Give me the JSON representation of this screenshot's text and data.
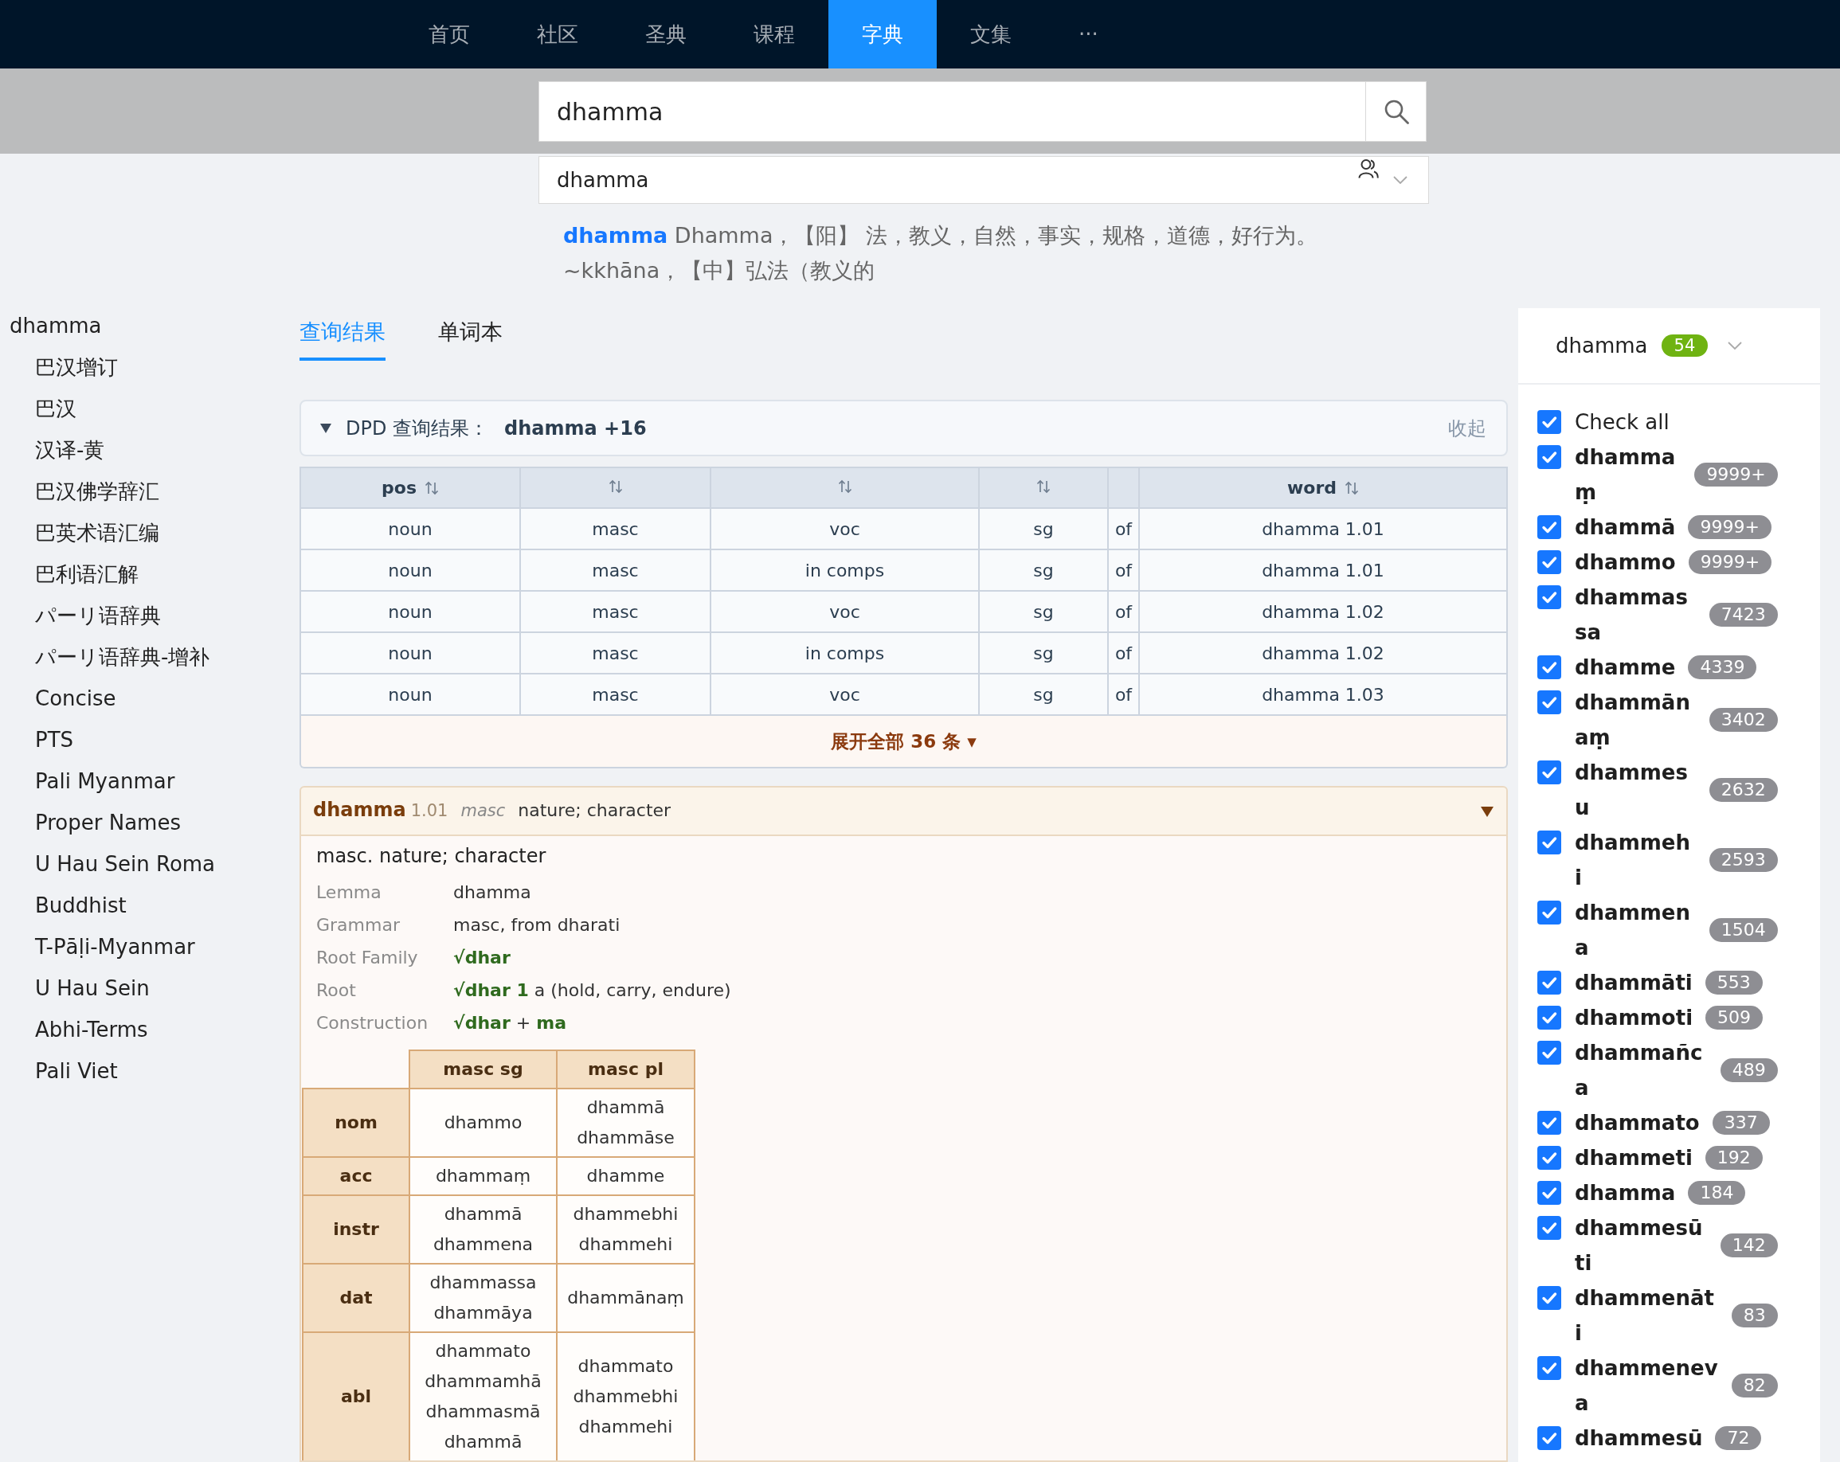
{
  "nav": {
    "items": [
      {
        "label": "首页",
        "selected": false
      },
      {
        "label": "社区",
        "selected": false
      },
      {
        "label": "圣典",
        "selected": false
      },
      {
        "label": "课程",
        "selected": false
      },
      {
        "label": "字典",
        "selected": true
      },
      {
        "label": "文集",
        "selected": false
      },
      {
        "label": "···",
        "selected": false
      }
    ]
  },
  "search": {
    "value": "dhamma"
  },
  "dictionary_select": {
    "value": "dhamma"
  },
  "definition": "**dhamma** Dhamma，【阳】 法，教义，自然，事实，规格，道德，好行为。~kkhāna，【中】弘法（教义的",
  "sidebar": {
    "tree": [
      {
        "label": "dhamma",
        "children": [
          {
            "label": "巴汉增订"
          },
          {
            "label": "巴汉"
          },
          {
            "label": "汉译-黄"
          },
          {
            "label": "巴汉佛学辞汇"
          },
          {
            "label": "巴英术语汇编"
          },
          {
            "label": "巴利语汇解"
          },
          {
            "label": "パーリ语辞典"
          },
          {
            "label": "パーリ语辞典-增补"
          },
          {
            "label": "Concise"
          },
          {
            "label": "PTS"
          },
          {
            "label": "Pali Myanmar"
          },
          {
            "label": "Proper Names"
          },
          {
            "label": "U Hau Sein Roma"
          },
          {
            "label": "Buddhist"
          },
          {
            "label": "T-Pāḷi-Myanmar"
          },
          {
            "label": "U Hau Sein"
          },
          {
            "label": "Abhi-Terms"
          },
          {
            "label": "Pali Viet"
          }
        ]
      }
    ]
  },
  "tabs": [
    {
      "label": "查询结果",
      "selected": true
    },
    {
      "label": "单词本",
      "selected": false
    }
  ],
  "dpd": {
    "expanded": true,
    "title": "DPD 查询结果：",
    "query": "dhamma +16",
    "collapse_label": "收起",
    "table": {
      "columns": [
        {
          "label": "pos",
          "sortable": true
        },
        {
          "sortable": true
        },
        {
          "sortable": true
        },
        {
          "sortable": true
        },
        {
          "sortable": false
        },
        {
          "label": "word",
          "sortable": true
        }
      ],
      "rows": [
        [
          "noun",
          "masc",
          "voc",
          "sg",
          "of",
          "dhamma 1.01"
        ],
        [
          "noun",
          "masc",
          "in comps",
          "sg",
          "of",
          "dhamma 1.01"
        ],
        [
          "noun",
          "masc",
          "voc",
          "sg",
          "of",
          "dhamma 1.02"
        ],
        [
          "noun",
          "masc",
          "in comps",
          "sg",
          "of",
          "dhamma 1.02"
        ],
        [
          "noun",
          "masc",
          "voc",
          "sg",
          "of",
          "dhamma 1.03"
        ]
      ]
    },
    "expand_all": "展开全部 36 条 ▾"
  },
  "entry": {
    "word": "dhamma",
    "homonym": "1.01",
    "pos": "masc",
    "meaning": "nature; character",
    "expanded": true,
    "summary": "masc. nature; character",
    "fields": [
      {
        "label": "Lemma",
        "value": "dhamma",
        "kind": "plain"
      },
      {
        "label": "Grammar",
        "value": "masc, from dharati",
        "kind": "plain"
      },
      {
        "label": "Root Family",
        "value": "√dhar",
        "kind": "root"
      },
      {
        "label": "Root",
        "value": "**√dhar 1** a (hold, carry, endure)",
        "kind": "plain"
      },
      {
        "label": "Construction",
        "value": "**√dhar** + **ma**",
        "kind": "plain"
      }
    ],
    "inflection": {
      "columns": [
        "masc sg",
        "masc pl"
      ],
      "rows": [
        {
          "case": "nom",
          "cells": [
            [
              "dhammo"
            ],
            [
              "dhammā",
              "dhammāse"
            ]
          ]
        },
        {
          "case": "acc",
          "cells": [
            [
              "dhammaṃ"
            ],
            [
              "dhamme"
            ]
          ]
        },
        {
          "case": "instr",
          "cells": [
            [
              "dhammā",
              "dhammena"
            ],
            [
              "dhammebhi",
              "dhammehi"
            ]
          ]
        },
        {
          "case": "dat",
          "cells": [
            [
              "dhammassa",
              "dhammāya"
            ],
            [
              "dhammānaṃ"
            ]
          ]
        },
        {
          "case": "abl",
          "cells": [
            [
              "dhammato",
              "dhammamhā",
              "dhammasmā",
              "dhammā"
            ],
            [
              "dhammato",
              "dhammebhi",
              "dhammehi"
            ]
          ]
        }
      ]
    }
  },
  "word_filter": {
    "word": "dhamma",
    "count": "54",
    "check_all": {
      "label": "Check all",
      "checked": true
    },
    "items": [
      {
        "word": "dhammaṃ",
        "count": "9999+",
        "checked": true
      },
      {
        "word": "dhammā",
        "count": "9999+",
        "checked": true
      },
      {
        "word": "dhammo",
        "count": "9999+",
        "checked": true
      },
      {
        "word": "dhammassa",
        "count": "7423",
        "checked": true
      },
      {
        "word": "dhamme",
        "count": "4339",
        "checked": true
      },
      {
        "word": "dhammānaṃ",
        "count": "3402",
        "checked": true
      },
      {
        "word": "dhammesu",
        "count": "2632",
        "checked": true
      },
      {
        "word": "dhammehi",
        "count": "2593",
        "checked": true
      },
      {
        "word": "dhammena",
        "count": "1504",
        "checked": true
      },
      {
        "word": "dhammāti",
        "count": "553",
        "checked": true
      },
      {
        "word": "dhammoti",
        "count": "509",
        "checked": true
      },
      {
        "word": "dhammañca",
        "count": "489",
        "checked": true
      },
      {
        "word": "dhammato",
        "count": "337",
        "checked": true
      },
      {
        "word": "dhammeti",
        "count": "192",
        "checked": true
      },
      {
        "word": "dhamma",
        "count": "184",
        "checked": true
      },
      {
        "word": "dhammesūti",
        "count": "142",
        "checked": true
      },
      {
        "word": "dhammenāti",
        "count": "83",
        "checked": true
      },
      {
        "word": "dhammeneva",
        "count": "82",
        "checked": true
      },
      {
        "word": "dhammesū",
        "count": "72",
        "checked": true
      }
    ]
  }
}
